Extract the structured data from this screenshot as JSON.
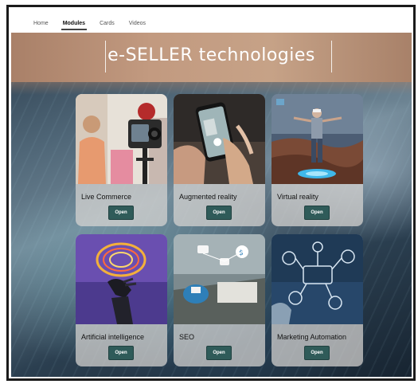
{
  "nav": {
    "tabs": [
      {
        "label": "Home",
        "active": false
      },
      {
        "label": "Modules",
        "active": true
      },
      {
        "label": "Cards",
        "active": false
      },
      {
        "label": "Videos",
        "active": false
      }
    ]
  },
  "banner": {
    "title": "e-SELLER technologies",
    "color": "#c29a80"
  },
  "cards": [
    {
      "title": "Live Commerce",
      "button": "Open",
      "image_icon": "camera-icon"
    },
    {
      "title": "Augmented reality",
      "button": "Open",
      "image_icon": "smartphone-icon"
    },
    {
      "title": "Virtual reality",
      "button": "Open",
      "image_icon": "vr-headset-icon"
    },
    {
      "title": "Artificial intelligence",
      "button": "Open",
      "image_icon": "robot-hand-icon"
    },
    {
      "title": "SEO",
      "button": "Open",
      "image_icon": "seo-network-icon"
    },
    {
      "title": "Marketing Automation",
      "button": "Open",
      "image_icon": "automation-network-icon"
    }
  ],
  "colors": {
    "button": "#2f5b59",
    "card_background": "#d8d6d2"
  }
}
